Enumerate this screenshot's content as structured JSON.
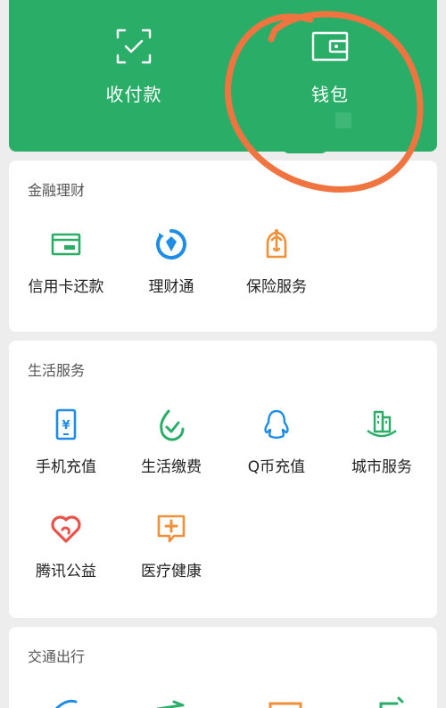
{
  "header": {
    "pay_label": "收付款",
    "wallet_label": "钱包",
    "bg_color": "#2aae67"
  },
  "finance": {
    "title": "金融理财",
    "items": [
      {
        "label": "信用卡还款",
        "icon": "credit-card-icon",
        "color": "#2aae67"
      },
      {
        "label": "理财通",
        "icon": "wealth-icon",
        "color": "#1f8de6"
      },
      {
        "label": "保险服务",
        "icon": "insurance-umbrella-icon",
        "color": "#f0913a"
      }
    ]
  },
  "life": {
    "title": "生活服务",
    "items": [
      {
        "label": "手机充值",
        "icon": "phone-icon",
        "color": "#1f8de6"
      },
      {
        "label": "生活缴费",
        "icon": "bill-pay-icon",
        "color": "#2aae67"
      },
      {
        "label": "Q币充值",
        "icon": "qq-penguin-icon",
        "color": "#1f8de6"
      },
      {
        "label": "城市服务",
        "icon": "city-icon",
        "color": "#2aae67"
      },
      {
        "label": "腾讯公益",
        "icon": "charity-heart-icon",
        "color": "#e9534b"
      },
      {
        "label": "医疗健康",
        "icon": "medical-icon",
        "color": "#f0913a"
      }
    ]
  },
  "transport": {
    "title": "交通出行"
  },
  "annotation_color": "#f0743f"
}
